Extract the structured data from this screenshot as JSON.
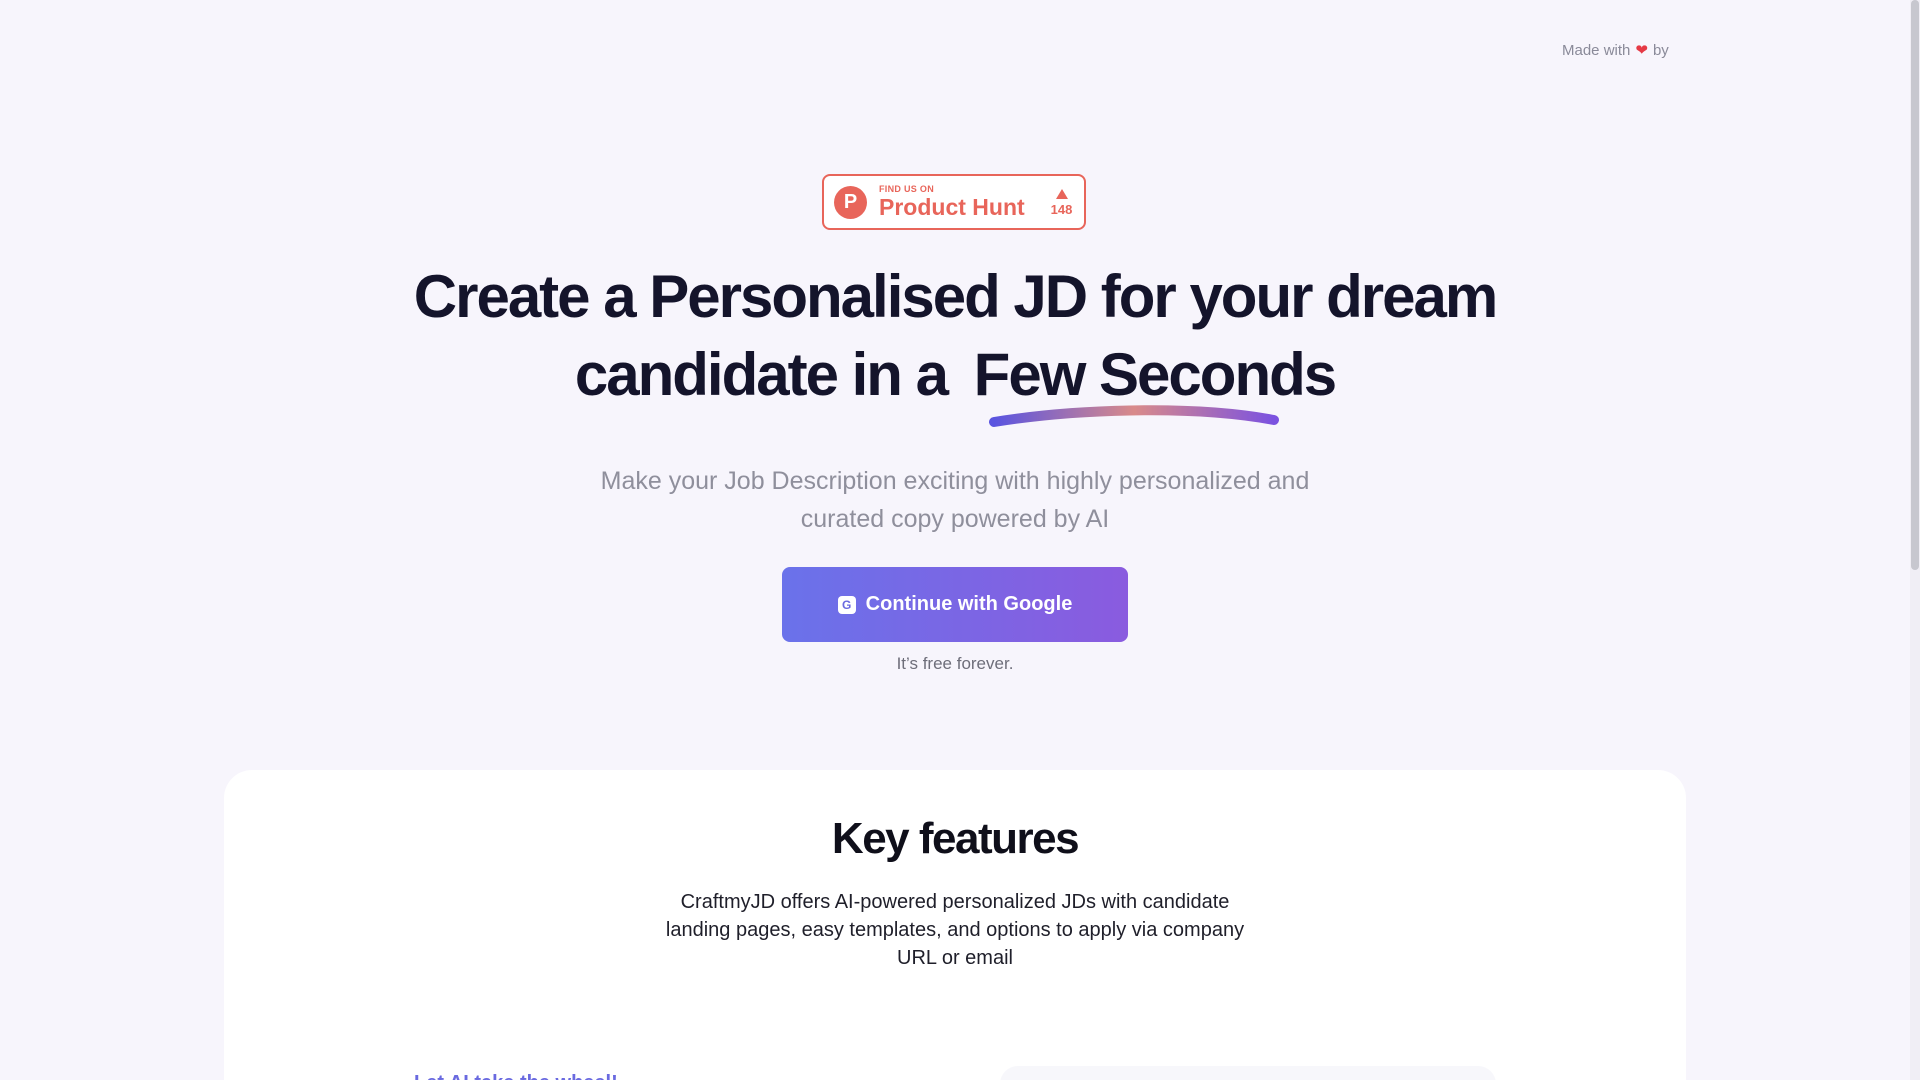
{
  "made_with": {
    "prefix": "Made with",
    "heart_icon": "heart-icon",
    "suffix": "by"
  },
  "product_hunt": {
    "small_label": "FIND US ON",
    "big_label": "Product Hunt",
    "logo_letter": "P",
    "upvote_icon": "triangle-up-icon",
    "votes": "148",
    "accent_color": "#e8655a"
  },
  "hero": {
    "headline_line1": "Create a Personalised JD for your dream",
    "headline_line2_prefix": "candidate in a",
    "headline_highlight": "Few Seconds",
    "subtitle_line1": "Make your Job Description exciting with highly personalized and",
    "subtitle_line2": "curated copy powered by AI"
  },
  "cta": {
    "icon": "google-icon",
    "icon_letter": "G",
    "label": "Continue with Google",
    "gradient_start": "#6a72ea",
    "gradient_end": "#8a5bdf",
    "note": "It’s free forever."
  },
  "features": {
    "title": "Key features",
    "description": "CraftmyJD offers AI-powered personalized JDs with candidate landing pages, easy templates, and options to apply via company URL or email",
    "peek_heading": "Let AI take the wheel!"
  },
  "colors": {
    "background": "#f7f5fc",
    "headline": "#14142b",
    "accent": "#6a6ae0"
  }
}
